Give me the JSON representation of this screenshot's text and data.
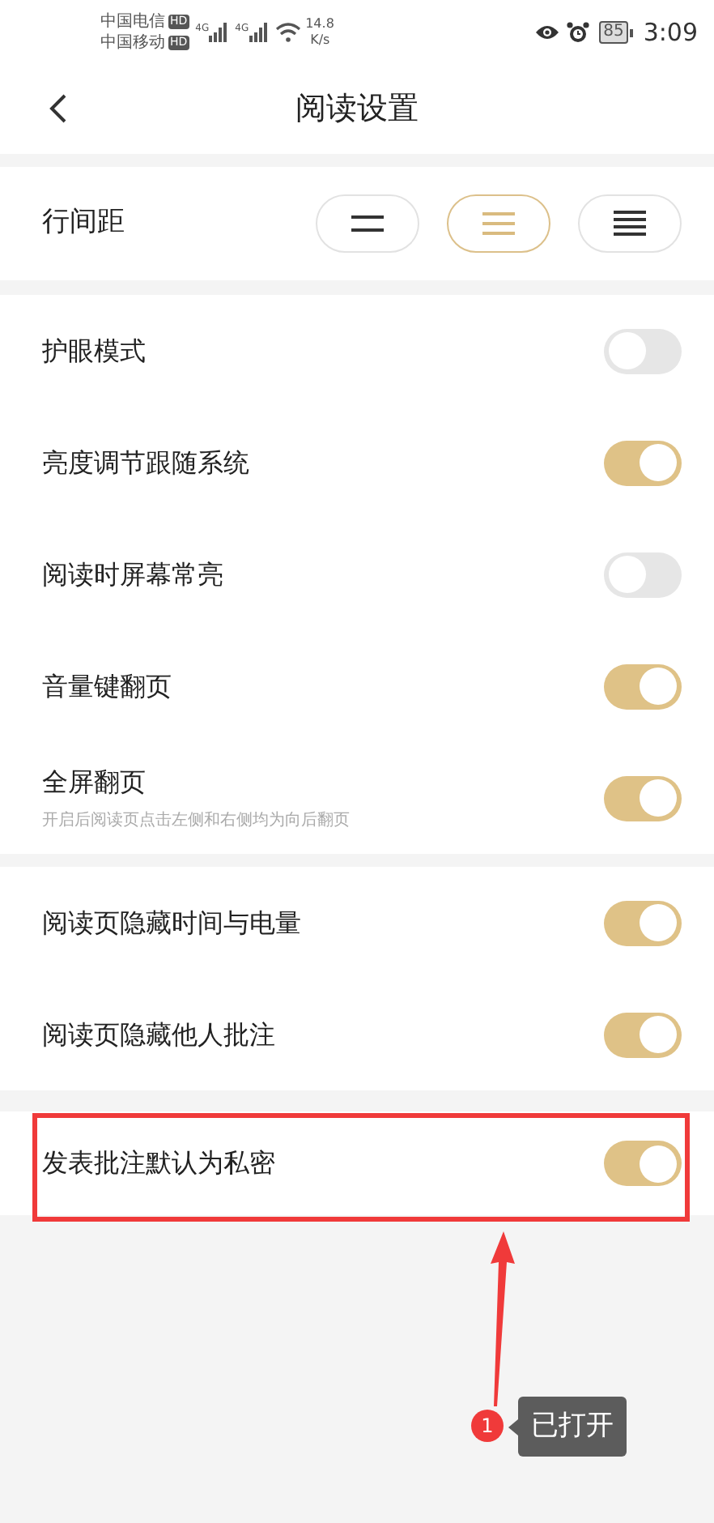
{
  "status_bar": {
    "carrier_1": "中国电信",
    "carrier_1_badge": "HD",
    "carrier_2": "中国移动",
    "carrier_2_badge": "HD",
    "network_1": "4G",
    "network_2": "4G",
    "speed_value": "14.8",
    "speed_unit": "K/s",
    "battery": "85",
    "time": "3:09"
  },
  "header": {
    "title": "阅读设置"
  },
  "line_spacing": {
    "label": "行间距",
    "options": [
      {
        "kind": "wide",
        "selected": false
      },
      {
        "kind": "medium",
        "selected": true
      },
      {
        "kind": "narrow",
        "selected": false
      }
    ]
  },
  "groups": [
    {
      "items": [
        {
          "label": "护眼模式",
          "on": false
        },
        {
          "label": "亮度调节跟随系统",
          "on": true
        },
        {
          "label": "阅读时屏幕常亮",
          "on": false
        },
        {
          "label": "音量键翻页",
          "on": true
        },
        {
          "label": "全屏翻页",
          "description": "开启后阅读页点击左侧和右侧均为向后翻页",
          "on": true
        }
      ]
    },
    {
      "items": [
        {
          "label": "阅读页隐藏时间与电量",
          "on": true
        },
        {
          "label": "阅读页隐藏他人批注",
          "on": true
        }
      ]
    },
    {
      "items": [
        {
          "label": "发表批注默认为私密",
          "on": true
        }
      ]
    }
  ],
  "annotation": {
    "step": "1",
    "callout": "已打开"
  }
}
